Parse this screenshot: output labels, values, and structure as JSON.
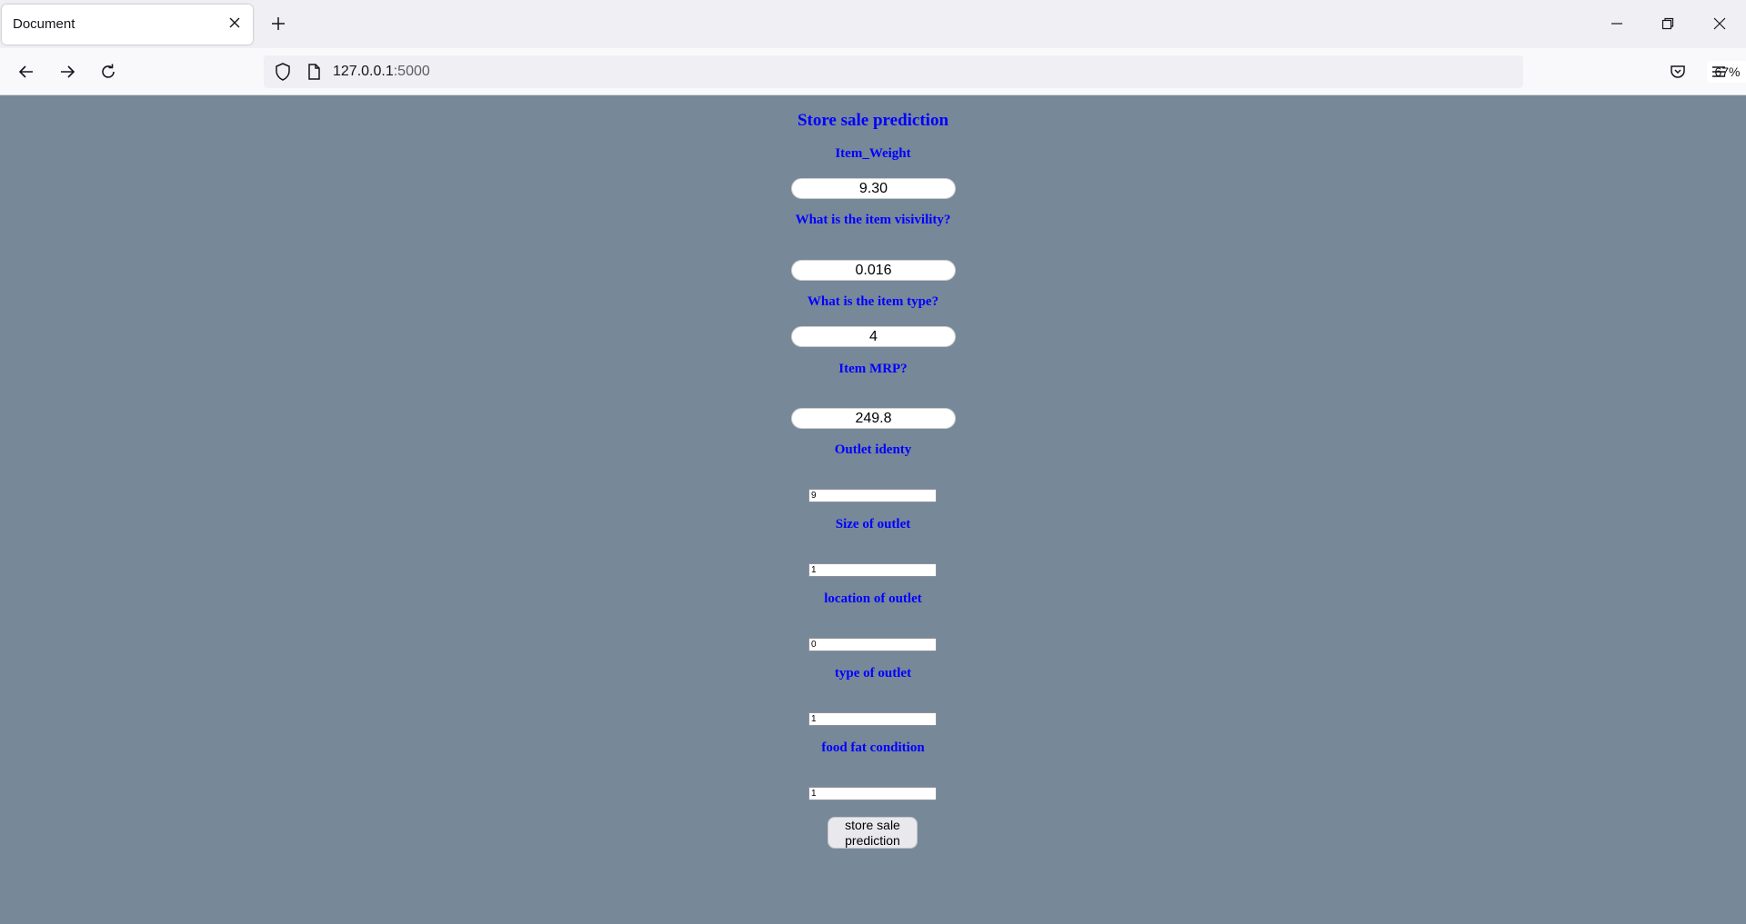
{
  "browser": {
    "tab_title": "Document",
    "url_host": "127.0.0.1",
    "url_port": ":5000",
    "zoom": "67%"
  },
  "form": {
    "title": "Store sale prediction",
    "fields": [
      {
        "label": "Item_Weight",
        "value": "9.30"
      },
      {
        "label": "What is the item visivility?",
        "value": "0.016"
      },
      {
        "label": "What is the item type?",
        "value": "4"
      },
      {
        "label": "Item MRP?",
        "value": "249.8"
      },
      {
        "label": "Outlet identy",
        "value": "9"
      },
      {
        "label": "Size of outlet",
        "value": "1"
      },
      {
        "label": "location of outlet",
        "value": "0"
      },
      {
        "label": "type of outlet",
        "value": "1"
      },
      {
        "label": "food fat condition",
        "value": "1"
      }
    ],
    "submit_label": "store sale prediction"
  },
  "colors": {
    "page_background": "#778899",
    "label_color": "#0000ff"
  }
}
